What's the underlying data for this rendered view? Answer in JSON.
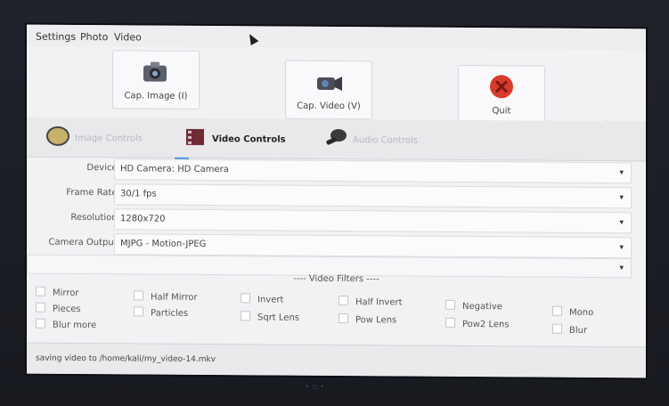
{
  "menu": {
    "items": [
      "Settings",
      "Photo",
      "Video"
    ]
  },
  "toolbar": {
    "cap_image": "Cap. Image (I)",
    "cap_video": "Cap. Video (V)",
    "quit": "Quit"
  },
  "tabs": [
    "Image Controls",
    "Video Controls",
    "Audio Controls"
  ],
  "form": {
    "device": {
      "label": "Device:",
      "value": "HD Camera: HD Camera"
    },
    "frame_rate": {
      "label": "Frame Rate:",
      "value": "30/1 fps"
    },
    "resolution": {
      "label": "Resolution:",
      "value": "1280x720"
    },
    "camera_output": {
      "label": "Camera Output:",
      "value": "MJPG - Motion-JPEG"
    }
  },
  "filters": {
    "title": "---- Video Filters ----",
    "items": [
      "Mirror",
      "Half Mirror",
      "Invert",
      "Half Invert",
      "Negative",
      "Mono",
      "Pieces",
      "Particles",
      "Sqrt Lens",
      "Pow Lens",
      "Pow2 Lens",
      "Blur",
      "Blur more"
    ]
  },
  "status": {
    "text": "saving video to /home/kali/my_video-14.mkv"
  },
  "colors": {
    "accent_underline": "#4a90d9",
    "quit_red": "#d93b2b",
    "bolt_yellow": "#e8c21a"
  },
  "icons": [
    "camera-icon",
    "video-camera-icon",
    "quit-icon",
    "lightning-icon",
    "image-icon",
    "film-icon",
    "microphone-icon"
  ]
}
